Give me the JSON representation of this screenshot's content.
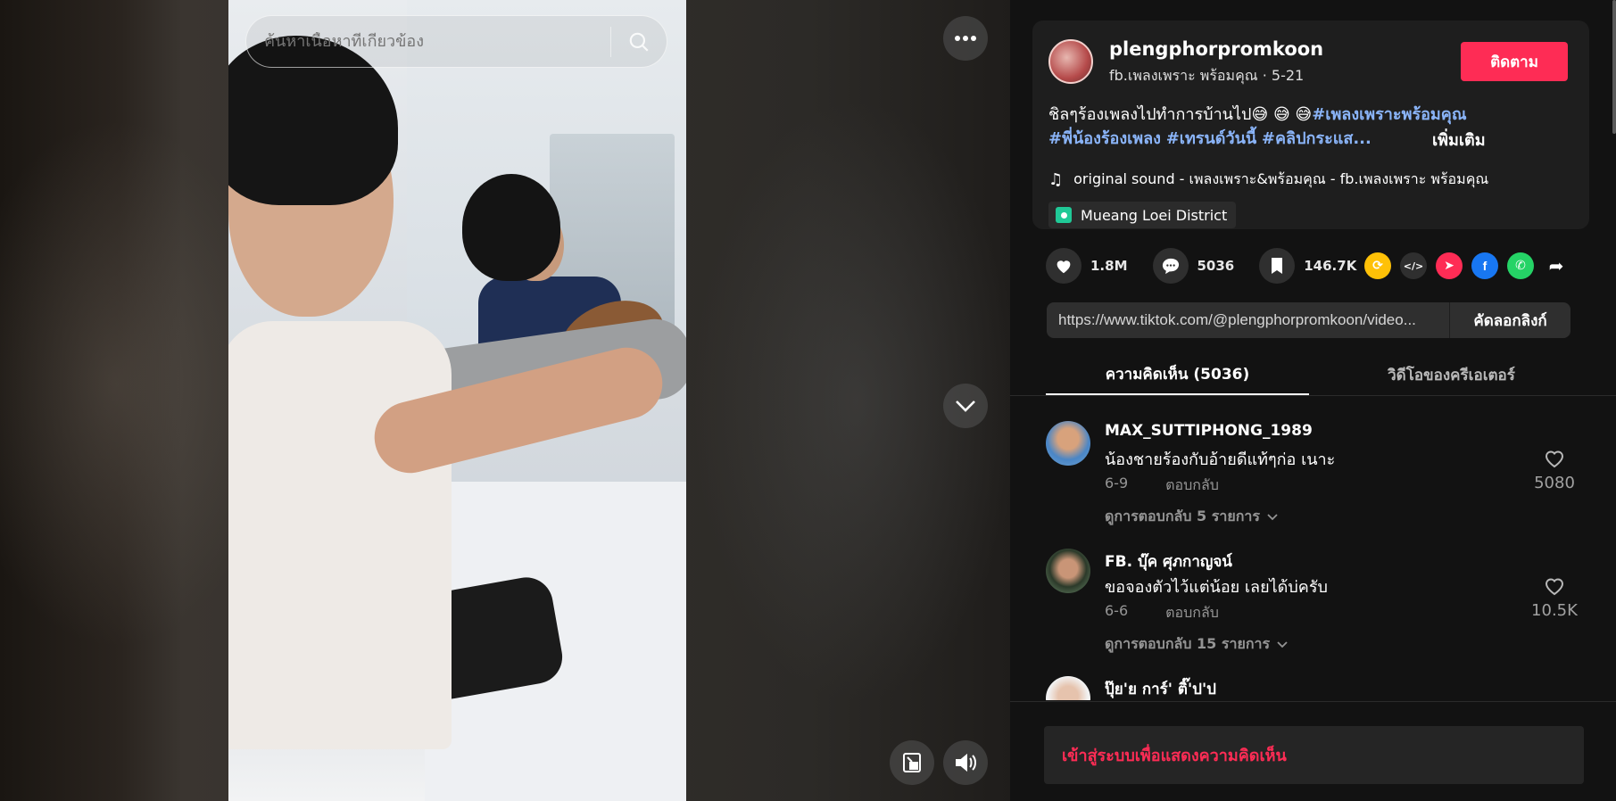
{
  "search": {
    "placeholder": "ค้นหาเนื้อหาที่เกี่ยวข้อง"
  },
  "post": {
    "username": "plengphorpromkoon",
    "subline": "fb.เพลงเพราะ พร้อมคุณ · 5-21",
    "follow_label": "ติดตาม",
    "caption_text": "ชิลๆร้องเพลงไปทำการบ้านไป😅 😅 😅",
    "hashtags": [
      "#เพลงเพราะพร้อมคุณ",
      "#พี่น้องร้องเพลง",
      "#เทรนด์วันนี้",
      "#คลิปกระแส..."
    ],
    "more_label": "เพิ่มเติม",
    "music": "original sound - เพลงเพราะ&พร้อมคุณ - fb.เพลงเพราะ พร้อมคุณ",
    "location": "Mueang Loei District"
  },
  "stats": {
    "likes": "1.8M",
    "comments": "5036",
    "saves": "146.7K"
  },
  "share": {
    "link": "https://www.tiktok.com/@plengphorpromkoon/video...",
    "copy_label": "คัดลอกลิงก์"
  },
  "tabs": [
    {
      "label": "ความคิดเห็น (5036)",
      "active": true
    },
    {
      "label": "วิดีโอของครีเอเตอร์",
      "active": false
    }
  ],
  "comments": [
    {
      "name": "MAX_SUTTIPHONG_1989",
      "text": "น้องชายร้องกับอ้ายดีแท้ๆก่อ เนาะ",
      "date": "6-9",
      "reply": "ตอบกลับ",
      "likes": "5080",
      "view_replies": "ดูการตอบกลับ 5 รายการ"
    },
    {
      "name": "FB. บุ๊ค ศุภกาญจน์",
      "text": "ขอจองตัวไว้แต่น้อย เลยได้บ่ครับ",
      "date": "6-6",
      "reply": "ตอบกลับ",
      "likes": "10.5K",
      "view_replies": "ดูการตอบกลับ 15 รายการ"
    },
    {
      "name": "ปุ๊ย'ย การ์' ติ๊'ป'ป",
      "text": "",
      "date": "",
      "reply": "",
      "likes": "",
      "view_replies": ""
    }
  ],
  "login_prompt": "เข้าสู่ระบบเพื่อแสดงความคิดเห็น",
  "colors": {
    "accent": "#fe2c55",
    "hashtag": "#8ab4f8",
    "panel": "#1e1e1e",
    "background": "#121212"
  }
}
